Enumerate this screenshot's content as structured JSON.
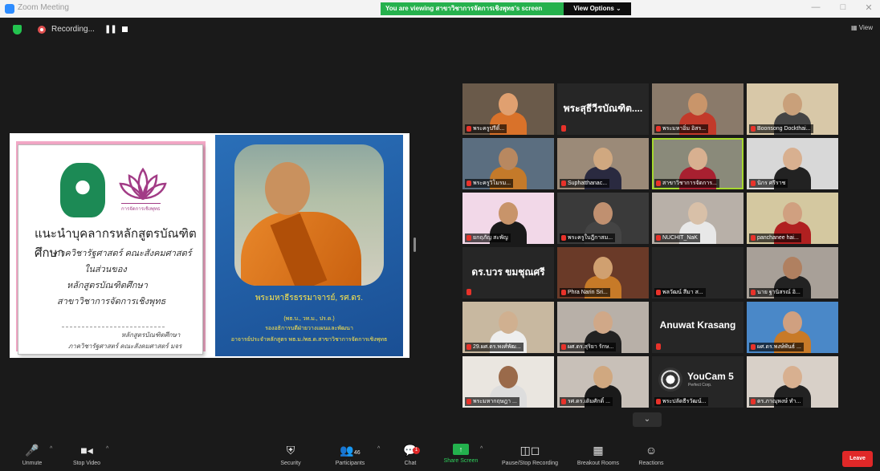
{
  "window": {
    "title": "Zoom Meeting"
  },
  "banner": {
    "viewing_text": "You are viewing สาขาวิชาการจัดการเชิงพุทธ's screen",
    "view_options": "View Options ⌄"
  },
  "recording": {
    "label": "Recording...",
    "pause": "❚❚"
  },
  "top_right": {
    "view_label": "▦ View"
  },
  "slide": {
    "lotus_caption": "การจัดการเชิงพุทธ",
    "title": "แนะนำบุคลากรหลักสูตรบัณฑิตศึกษา",
    "lines": [
      "ภาควิชารัฐศาสตร์ คณะสังคมศาสตร์",
      "ในส่วนของ",
      "หลักสูตรบัณฑิตศึกษา",
      "สาขาวิชาการจัดการเชิงพุทธ"
    ],
    "footer": [
      "หลักสูตรบัณฑิตศึกษา",
      "ภาควิชารัฐศาสตร์ คณะสังคมศาสตร์ มจร"
    ],
    "teacher": {
      "name": "พระมหาธีรธรรมาจารย์, รศ.ดร.",
      "degree": "(พธ.บ., วท.ม., ปร.ด.)",
      "role1": "รองอธิการบดีฝ่ายวางแผนและพัฒนา",
      "role2": "อาจารย์ประจำหลักสูตร พธ.ม./พธ.ด.สาขาวิชาการจัดการเชิงพุทธ"
    }
  },
  "gallery": {
    "tiles": [
      {
        "name": "พระครูปรีดิ์...",
        "type": "video"
      },
      {
        "name": "",
        "type": "name",
        "big": "พระสุธีวีรบัณฑิต...."
      },
      {
        "name": "พระมหาอิ่ม อิสร...",
        "type": "video"
      },
      {
        "name": "Boonsong Dockthai...",
        "type": "video"
      },
      {
        "name": "พระครูวิโมรม...",
        "type": "video"
      },
      {
        "name": "Suphatthanac...",
        "type": "video"
      },
      {
        "name": "สาขาวิชาการจัดการ...",
        "type": "video",
        "active": true
      },
      {
        "name": "นิกร ศรีราช",
        "type": "video"
      },
      {
        "name": "ยกฤภัญ สะพัญ",
        "type": "video"
      },
      {
        "name": "พระครูใบฎีกาสม...",
        "type": "video"
      },
      {
        "name": "NUCHIT_NaK",
        "type": "video"
      },
      {
        "name": "panchanee hai...",
        "type": "video"
      },
      {
        "name": "",
        "type": "name",
        "big": "ดร.บวร ขมชุณศรี"
      },
      {
        "name": "Phra Narin Sri...",
        "type": "video"
      },
      {
        "name": "พลวัฒน์ สีมา ส...",
        "type": "video"
      },
      {
        "name": "นาย ฐานิสรณ์ อิ...",
        "type": "video"
      },
      {
        "name": "29.ผศ.ดร.พงศ์พัฒ...",
        "type": "video"
      },
      {
        "name": "ผศ.ดร.สุริยา รักษ...",
        "type": "video"
      },
      {
        "name": "",
        "type": "name",
        "big": "Anuwat Krasang"
      },
      {
        "name": "ผศ.ดร.พงษ์พันธ์ ...",
        "type": "video"
      },
      {
        "name": "พระมหากฤษฎา ...",
        "type": "video"
      },
      {
        "name": "รศ.ดร.เติมศักดิ์ ...",
        "type": "video"
      },
      {
        "name": "พระปลัดธีรวัฒน์...",
        "type": "youcam",
        "brand": "YouCam 5",
        "brand_sub": "Perfect Corp."
      },
      {
        "name": "ดร.ภาณุพงษ์ ทำ...",
        "type": "video"
      }
    ],
    "scroll_down": "⌄"
  },
  "toolbar": {
    "unmute": "Unmute",
    "stop_video": "Stop Video",
    "security": "Security",
    "participants": "Participants",
    "participants_count": "46",
    "chat": "Chat",
    "chat_badge": "1",
    "share_screen": "Share Screen",
    "pause_recording": "Pause/Stop Recording",
    "breakout": "Breakout Rooms",
    "reactions": "Reactions",
    "leave": "Leave"
  },
  "colors": {
    "banner_green": "#26b14d",
    "active_speaker": "#a6d82f",
    "leave_red": "#e02828",
    "zoom_blue": "#2d8cff"
  }
}
